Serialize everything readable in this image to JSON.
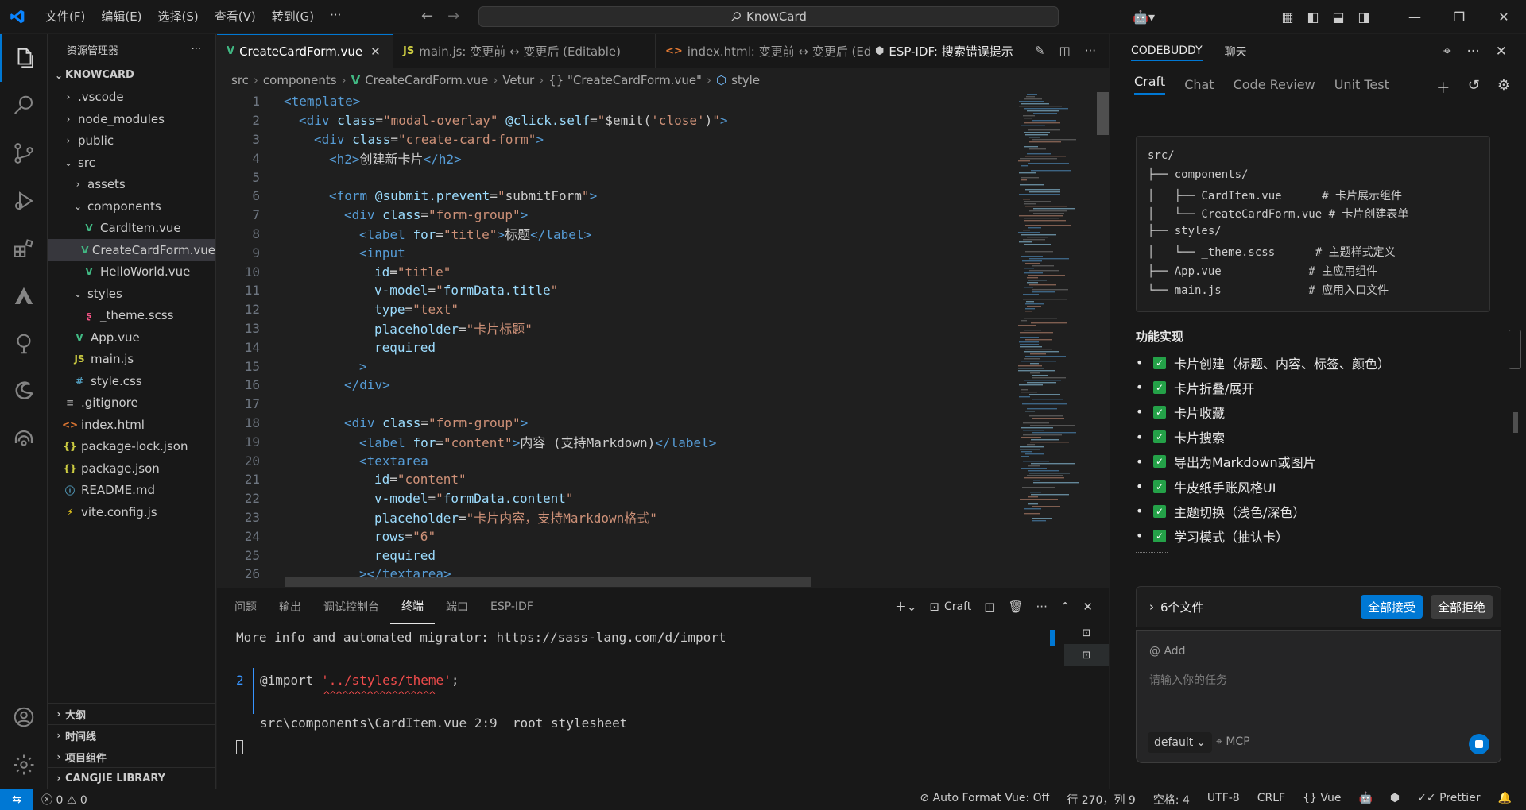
{
  "titlebar": {
    "menu": [
      "文件(F)",
      "编辑(E)",
      "选择(S)",
      "查看(V)",
      "转到(G)",
      "···"
    ],
    "search": "KnowCard"
  },
  "sidebar": {
    "title": "资源管理器",
    "root": "KNOWCARD",
    "items": [
      {
        "label": ".vscode",
        "type": "folder",
        "depth": 1,
        "open": false
      },
      {
        "label": "node_modules",
        "type": "folder",
        "depth": 1,
        "open": false
      },
      {
        "label": "public",
        "type": "folder",
        "depth": 1,
        "open": false
      },
      {
        "label": "src",
        "type": "folder",
        "depth": 1,
        "open": true
      },
      {
        "label": "assets",
        "type": "folder",
        "depth": 2,
        "open": false
      },
      {
        "label": "components",
        "type": "folder",
        "depth": 2,
        "open": true
      },
      {
        "label": "CardItem.vue",
        "type": "vue",
        "depth": 3
      },
      {
        "label": "CreateCardForm.vue",
        "type": "vue",
        "depth": 3,
        "selected": true
      },
      {
        "label": "HelloWorld.vue",
        "type": "vue",
        "depth": 3
      },
      {
        "label": "styles",
        "type": "folder",
        "depth": 2,
        "open": true
      },
      {
        "label": "_theme.scss",
        "type": "scss",
        "depth": 3
      },
      {
        "label": "App.vue",
        "type": "vue",
        "depth": 2
      },
      {
        "label": "main.js",
        "type": "js",
        "depth": 2
      },
      {
        "label": "style.css",
        "type": "css",
        "depth": 2
      },
      {
        "label": ".gitignore",
        "type": "text",
        "depth": 1
      },
      {
        "label": "index.html",
        "type": "html",
        "depth": 1
      },
      {
        "label": "package-lock.json",
        "type": "json",
        "depth": 1
      },
      {
        "label": "package.json",
        "type": "json",
        "depth": 1
      },
      {
        "label": "README.md",
        "type": "info",
        "depth": 1
      },
      {
        "label": "vite.config.js",
        "type": "vite",
        "depth": 1
      }
    ],
    "bottom_sections": [
      "大纲",
      "时间线",
      "项目组件",
      "CANGJIE LIBRARY"
    ]
  },
  "tabs": [
    {
      "label": "CreateCardForm.vue",
      "icon": "V",
      "active": true
    },
    {
      "label": "main.js: 变更前 ↔ 变更后 (Editable)",
      "icon": "JS"
    },
    {
      "label": "index.html: 变更前 ↔ 变更后 (Ed",
      "icon": "<>"
    },
    {
      "label": "ESP-IDF:  搜索错误提示",
      "icon": "esp"
    }
  ],
  "breadcrumb": [
    "src",
    "components",
    "CreateCardForm.vue",
    "Vetur",
    "{} \"CreateCardForm.vue\"",
    "style"
  ],
  "code_lines": [
    {
      "n": "1",
      "indent": 0,
      "html": "<span class='tg'>&lt;template&gt;</span>"
    },
    {
      "n": "2",
      "indent": 1,
      "html": "<span class='tg'>&lt;div</span> <span class='at'>class</span>=<span class='st'>\"modal-overlay\"</span> <span class='at'>@click.self</span>=<span class='st'>\"</span><span class='pl'>$emit(</span><span class='st'>'close'</span><span class='pl'>)</span><span class='st'>\"</span><span class='tg'>&gt;</span>"
    },
    {
      "n": "3",
      "indent": 2,
      "html": "<span class='tg'>&lt;div</span> <span class='at'>class</span>=<span class='st'>\"create-card-form\"</span><span class='tg'>&gt;</span>"
    },
    {
      "n": "4",
      "indent": 3,
      "html": "<span class='tg'>&lt;h2&gt;</span>创建新卡片<span class='tg'>&lt;/h2&gt;</span>"
    },
    {
      "n": "5",
      "indent": 0,
      "html": ""
    },
    {
      "n": "6",
      "indent": 3,
      "html": "<span class='tg'>&lt;form</span> <span class='at'>@submit.prevent</span>=<span class='st'>\"</span><span class='pl'>submitForm</span><span class='st'>\"</span><span class='tg'>&gt;</span>"
    },
    {
      "n": "7",
      "indent": 4,
      "html": "<span class='tg'>&lt;div</span> <span class='at'>class</span>=<span class='st'>\"form-group\"</span><span class='tg'>&gt;</span>"
    },
    {
      "n": "8",
      "indent": 5,
      "html": "<span class='tg'>&lt;label</span> <span class='at'>for</span>=<span class='st'>\"title\"</span><span class='tg'>&gt;</span>标题<span class='tg'>&lt;/label&gt;</span>"
    },
    {
      "n": "9",
      "indent": 5,
      "html": "<span class='tg'>&lt;input</span>"
    },
    {
      "n": "10",
      "indent": 6,
      "html": "<span class='at'>id</span>=<span class='st'>\"title\"</span>"
    },
    {
      "n": "11",
      "indent": 6,
      "html": "<span class='at'>v-model</span>=<span class='st'>\"</span><span class='at'>formData.title</span><span class='st'>\"</span>"
    },
    {
      "n": "12",
      "indent": 6,
      "html": "<span class='at'>type</span>=<span class='st'>\"text\"</span>"
    },
    {
      "n": "13",
      "indent": 6,
      "html": "<span class='at'>placeholder</span>=<span class='st'>\"卡片标题\"</span>"
    },
    {
      "n": "14",
      "indent": 6,
      "html": "<span class='at'>required</span>"
    },
    {
      "n": "15",
      "indent": 5,
      "html": "<span class='tg'>&gt;</span>"
    },
    {
      "n": "16",
      "indent": 4,
      "html": "<span class='tg'>&lt;/div&gt;</span>"
    },
    {
      "n": "17",
      "indent": 0,
      "html": ""
    },
    {
      "n": "18",
      "indent": 4,
      "html": "<span class='tg'>&lt;div</span> <span class='at'>class</span>=<span class='st'>\"form-group\"</span><span class='tg'>&gt;</span>"
    },
    {
      "n": "19",
      "indent": 5,
      "html": "<span class='tg'>&lt;label</span> <span class='at'>for</span>=<span class='st'>\"content\"</span><span class='tg'>&gt;</span>内容 (支持Markdown)<span class='tg'>&lt;/label&gt;</span>"
    },
    {
      "n": "20",
      "indent": 5,
      "html": "<span class='tg'>&lt;textarea</span>"
    },
    {
      "n": "21",
      "indent": 6,
      "html": "<span class='at'>id</span>=<span class='st'>\"content\"</span>"
    },
    {
      "n": "22",
      "indent": 6,
      "html": "<span class='at'>v-model</span>=<span class='st'>\"</span><span class='at'>formData.content</span><span class='st'>\"</span>"
    },
    {
      "n": "23",
      "indent": 6,
      "html": "<span class='at'>placeholder</span>=<span class='st'>\"卡片内容，支持Markdown格式\"</span>"
    },
    {
      "n": "24",
      "indent": 6,
      "html": "<span class='at'>rows</span>=<span class='st'>\"6\"</span>"
    },
    {
      "n": "25",
      "indent": 6,
      "html": "<span class='at'>required</span>"
    },
    {
      "n": "26",
      "indent": 5,
      "html": "<span class='tg'>&gt;&lt;/textarea&gt;</span>"
    }
  ],
  "panel": {
    "tabs": [
      "问题",
      "输出",
      "调试控制台",
      "终端",
      "端口",
      "ESP-IDF"
    ],
    "active_tab": "终端",
    "terminal_name": "Craft",
    "terminal": {
      "line1": "More info and automated migrator: https://sass-lang.com/d/import",
      "gutter_num": "2",
      "import_kw": "@import ",
      "import_path": "'../styles/theme'",
      "import_end": ";",
      "carets": "^^^^^^^^^^^^^^^^^^",
      "location": "src\\components\\CardItem.vue 2:9  root stylesheet"
    }
  },
  "chat": {
    "brand": "CODEBUDDY",
    "tab2": "聊天",
    "subtabs": [
      "Craft",
      "Chat",
      "Code Review",
      "Unit Test"
    ],
    "tree": [
      "src/",
      "├── components/",
      "│   ├── CardItem.vue      # 卡片展示组件",
      "│   └── CreateCardForm.vue # 卡片创建表单",
      "├── styles/",
      "│   └── _theme.scss      # 主题样式定义",
      "├── App.vue             # 主应用组件",
      "└── main.js             # 应用入口文件"
    ],
    "features_title": "功能实现",
    "features": [
      "卡片创建（标题、内容、标签、颜色）",
      "卡片折叠/展开",
      "卡片收藏",
      "卡片搜索",
      "导出为Markdown或图片",
      "牛皮纸手账风格UI",
      "主题切换（浅色/深色）",
      "学习模式（抽认卡）"
    ],
    "files_label": "6个文件",
    "accept_all": "全部接受",
    "reject_all": "全部拒绝",
    "add_label": "@ Add",
    "input_placeholder": "请输入你的任务",
    "model": "default",
    "mcp": "MCP"
  },
  "statusbar": {
    "errors": "0",
    "warnings": "0",
    "autoformat": "Auto Format Vue: Off",
    "position": "行 270，列 9",
    "spaces": "空格: 4",
    "encoding": "UTF-8",
    "eol": "CRLF",
    "language": "Vue",
    "prettier": "Prettier"
  },
  "colors": {
    "accent": "#0078d4",
    "vue": "#41b883",
    "success": "#24a148",
    "reject_btn": "#3c3c3c"
  }
}
